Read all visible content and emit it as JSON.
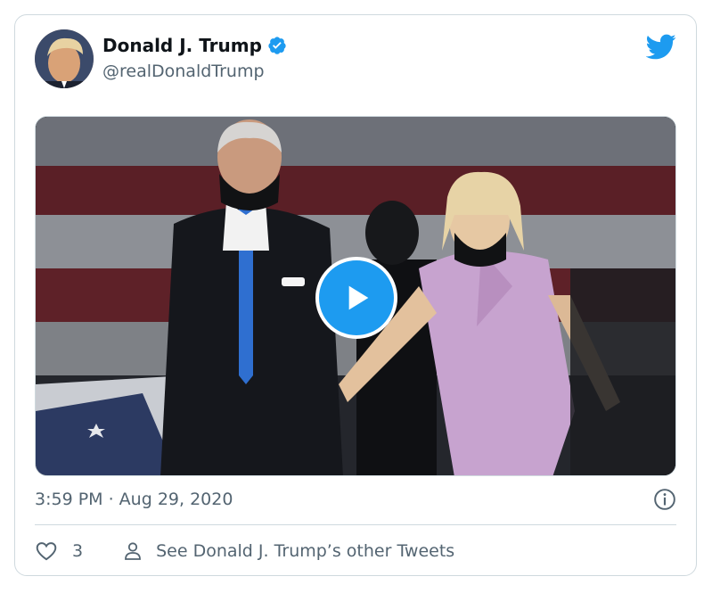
{
  "tweet": {
    "author": {
      "display_name": "Donald J. Trump",
      "handle": "@realDonaldTrump",
      "verified": true
    },
    "timestamp": "3:59 PM · Aug 29, 2020",
    "likes": "3",
    "other_tweets_label": "See Donald J. Trump’s other Tweets"
  },
  "media": {
    "type": "video",
    "play_icon": "play-icon"
  },
  "icons": {
    "logo": "twitter-bird-icon",
    "verified": "verified-badge-icon",
    "info": "info-icon",
    "like": "heart-icon",
    "profile": "person-icon"
  },
  "colors": {
    "accent": "#1d9bf0",
    "text_primary": "#0f1419",
    "text_secondary": "#536471",
    "border": "#cfd9de"
  }
}
